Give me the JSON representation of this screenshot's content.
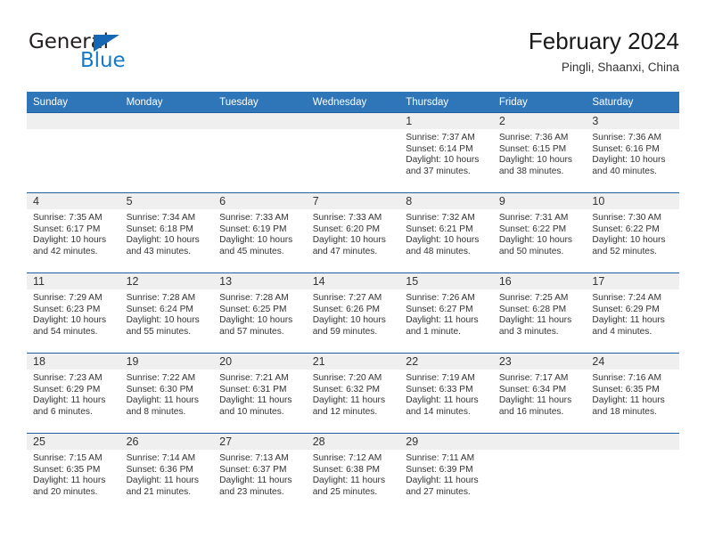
{
  "brand": {
    "name_part1": "General",
    "name_part2": "Blue",
    "color_dark": "#231f20",
    "color_blue": "#1878c8"
  },
  "header": {
    "title": "February 2024",
    "location": "Pingli, Shaanxi, China"
  },
  "theme": {
    "header_bg": "#2f76b8",
    "row_divider": "#1f5fa0",
    "daynum_bg": "#efefef",
    "text": "#333333"
  },
  "weekday_headers": [
    "Sunday",
    "Monday",
    "Tuesday",
    "Wednesday",
    "Thursday",
    "Friday",
    "Saturday"
  ],
  "weeks": [
    [
      {
        "day": "",
        "lines": []
      },
      {
        "day": "",
        "lines": []
      },
      {
        "day": "",
        "lines": []
      },
      {
        "day": "",
        "lines": []
      },
      {
        "day": "1",
        "lines": [
          "Sunrise: 7:37 AM",
          "Sunset: 6:14 PM",
          "Daylight: 10 hours",
          "and 37 minutes."
        ]
      },
      {
        "day": "2",
        "lines": [
          "Sunrise: 7:36 AM",
          "Sunset: 6:15 PM",
          "Daylight: 10 hours",
          "and 38 minutes."
        ]
      },
      {
        "day": "3",
        "lines": [
          "Sunrise: 7:36 AM",
          "Sunset: 6:16 PM",
          "Daylight: 10 hours",
          "and 40 minutes."
        ]
      }
    ],
    [
      {
        "day": "4",
        "lines": [
          "Sunrise: 7:35 AM",
          "Sunset: 6:17 PM",
          "Daylight: 10 hours",
          "and 42 minutes."
        ]
      },
      {
        "day": "5",
        "lines": [
          "Sunrise: 7:34 AM",
          "Sunset: 6:18 PM",
          "Daylight: 10 hours",
          "and 43 minutes."
        ]
      },
      {
        "day": "6",
        "lines": [
          "Sunrise: 7:33 AM",
          "Sunset: 6:19 PM",
          "Daylight: 10 hours",
          "and 45 minutes."
        ]
      },
      {
        "day": "7",
        "lines": [
          "Sunrise: 7:33 AM",
          "Sunset: 6:20 PM",
          "Daylight: 10 hours",
          "and 47 minutes."
        ]
      },
      {
        "day": "8",
        "lines": [
          "Sunrise: 7:32 AM",
          "Sunset: 6:21 PM",
          "Daylight: 10 hours",
          "and 48 minutes."
        ]
      },
      {
        "day": "9",
        "lines": [
          "Sunrise: 7:31 AM",
          "Sunset: 6:22 PM",
          "Daylight: 10 hours",
          "and 50 minutes."
        ]
      },
      {
        "day": "10",
        "lines": [
          "Sunrise: 7:30 AM",
          "Sunset: 6:22 PM",
          "Daylight: 10 hours",
          "and 52 minutes."
        ]
      }
    ],
    [
      {
        "day": "11",
        "lines": [
          "Sunrise: 7:29 AM",
          "Sunset: 6:23 PM",
          "Daylight: 10 hours",
          "and 54 minutes."
        ]
      },
      {
        "day": "12",
        "lines": [
          "Sunrise: 7:28 AM",
          "Sunset: 6:24 PM",
          "Daylight: 10 hours",
          "and 55 minutes."
        ]
      },
      {
        "day": "13",
        "lines": [
          "Sunrise: 7:28 AM",
          "Sunset: 6:25 PM",
          "Daylight: 10 hours",
          "and 57 minutes."
        ]
      },
      {
        "day": "14",
        "lines": [
          "Sunrise: 7:27 AM",
          "Sunset: 6:26 PM",
          "Daylight: 10 hours",
          "and 59 minutes."
        ]
      },
      {
        "day": "15",
        "lines": [
          "Sunrise: 7:26 AM",
          "Sunset: 6:27 PM",
          "Daylight: 11 hours",
          "and 1 minute."
        ]
      },
      {
        "day": "16",
        "lines": [
          "Sunrise: 7:25 AM",
          "Sunset: 6:28 PM",
          "Daylight: 11 hours",
          "and 3 minutes."
        ]
      },
      {
        "day": "17",
        "lines": [
          "Sunrise: 7:24 AM",
          "Sunset: 6:29 PM",
          "Daylight: 11 hours",
          "and 4 minutes."
        ]
      }
    ],
    [
      {
        "day": "18",
        "lines": [
          "Sunrise: 7:23 AM",
          "Sunset: 6:29 PM",
          "Daylight: 11 hours",
          "and 6 minutes."
        ]
      },
      {
        "day": "19",
        "lines": [
          "Sunrise: 7:22 AM",
          "Sunset: 6:30 PM",
          "Daylight: 11 hours",
          "and 8 minutes."
        ]
      },
      {
        "day": "20",
        "lines": [
          "Sunrise: 7:21 AM",
          "Sunset: 6:31 PM",
          "Daylight: 11 hours",
          "and 10 minutes."
        ]
      },
      {
        "day": "21",
        "lines": [
          "Sunrise: 7:20 AM",
          "Sunset: 6:32 PM",
          "Daylight: 11 hours",
          "and 12 minutes."
        ]
      },
      {
        "day": "22",
        "lines": [
          "Sunrise: 7:19 AM",
          "Sunset: 6:33 PM",
          "Daylight: 11 hours",
          "and 14 minutes."
        ]
      },
      {
        "day": "23",
        "lines": [
          "Sunrise: 7:17 AM",
          "Sunset: 6:34 PM",
          "Daylight: 11 hours",
          "and 16 minutes."
        ]
      },
      {
        "day": "24",
        "lines": [
          "Sunrise: 7:16 AM",
          "Sunset: 6:35 PM",
          "Daylight: 11 hours",
          "and 18 minutes."
        ]
      }
    ],
    [
      {
        "day": "25",
        "lines": [
          "Sunrise: 7:15 AM",
          "Sunset: 6:35 PM",
          "Daylight: 11 hours",
          "and 20 minutes."
        ]
      },
      {
        "day": "26",
        "lines": [
          "Sunrise: 7:14 AM",
          "Sunset: 6:36 PM",
          "Daylight: 11 hours",
          "and 21 minutes."
        ]
      },
      {
        "day": "27",
        "lines": [
          "Sunrise: 7:13 AM",
          "Sunset: 6:37 PM",
          "Daylight: 11 hours",
          "and 23 minutes."
        ]
      },
      {
        "day": "28",
        "lines": [
          "Sunrise: 7:12 AM",
          "Sunset: 6:38 PM",
          "Daylight: 11 hours",
          "and 25 minutes."
        ]
      },
      {
        "day": "29",
        "lines": [
          "Sunrise: 7:11 AM",
          "Sunset: 6:39 PM",
          "Daylight: 11 hours",
          "and 27 minutes."
        ]
      },
      {
        "day": "",
        "lines": []
      },
      {
        "day": "",
        "lines": []
      }
    ]
  ]
}
